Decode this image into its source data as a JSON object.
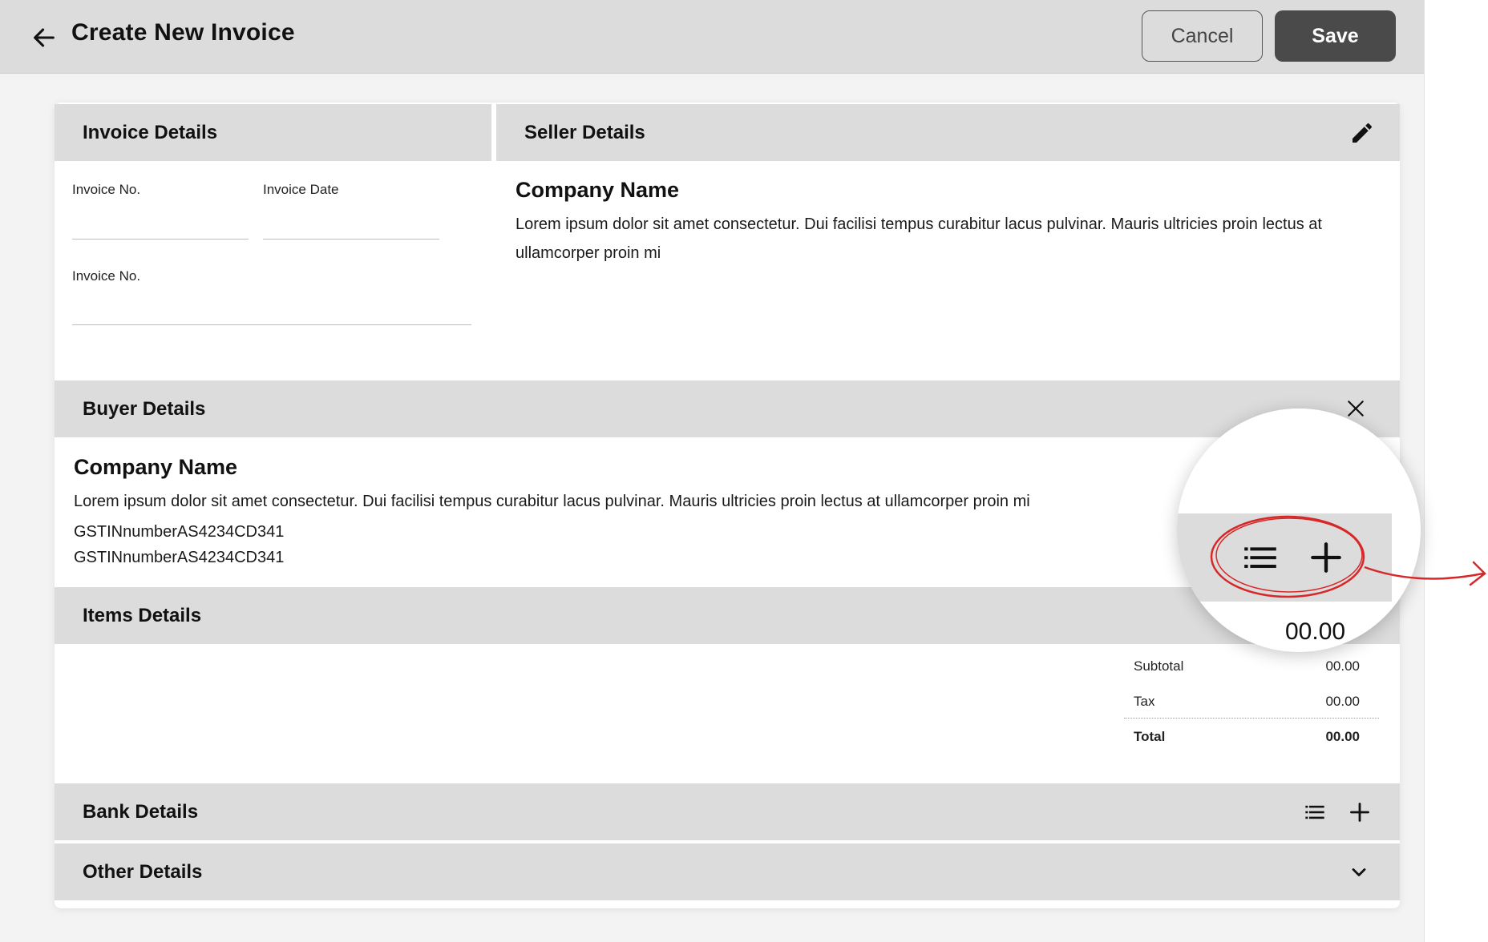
{
  "header": {
    "title": "Create New Invoice",
    "cancel_label": "Cancel",
    "save_label": "Save"
  },
  "invoice_details": {
    "title": "Invoice Details",
    "fields": [
      {
        "label": "Invoice No.",
        "value": ""
      },
      {
        "label": "Invoice Date",
        "value": ""
      },
      {
        "label": "Invoice No.",
        "value": ""
      }
    ]
  },
  "seller_details": {
    "title": "Seller Details",
    "company_name": "Company Name",
    "address": "Lorem ipsum dolor sit amet consectetur. Dui facilisi tempus curabitur lacus pulvinar. Mauris ultricies proin lectus at ullamcorper proin mi"
  },
  "buyer_details": {
    "title": "Buyer Details",
    "company_name": "Company Name",
    "address": "Lorem ipsum dolor sit amet consectetur. Dui facilisi tempus curabitur lacus pulvinar. Mauris ultricies proin lectus at ullamcorper proin mi",
    "gstin": [
      "GSTINnumberAS4234CD341",
      "GSTINnumberAS4234CD341"
    ]
  },
  "items_details": {
    "title": "Items Details",
    "zoom_amount": "00.00",
    "totals": [
      {
        "label": "Subtotal",
        "value": "00.00"
      },
      {
        "label": "Tax",
        "value": "00.00"
      },
      {
        "label": "Total",
        "value": "00.00"
      }
    ]
  },
  "bank_details": {
    "title": "Bank Details"
  },
  "other_details": {
    "title": "Other Details"
  },
  "colors": {
    "header_bg": "#dcdcdc",
    "save_bg": "#4a4a4a",
    "annotation": "#d62828"
  },
  "icons": [
    "arrow-left-icon",
    "pencil-icon",
    "list-icon",
    "plus-icon",
    "close-icon",
    "chevron-down-icon"
  ]
}
